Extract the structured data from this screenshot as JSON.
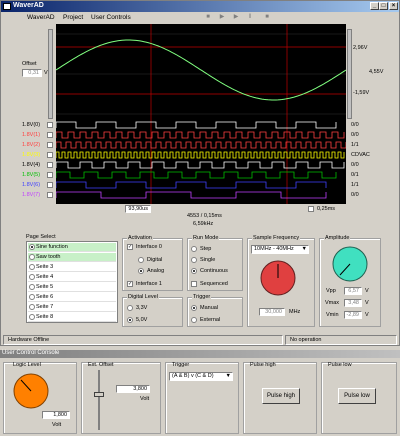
{
  "window": {
    "title": "WaverAD"
  },
  "menu": [
    "WaverAD",
    "Project",
    "User Controls"
  ],
  "scope": {
    "offset_label": "Offset",
    "offset_value": "0,31",
    "offset_unit": "V",
    "top_level": "2,96V",
    "right_level": "4,55V",
    "bottom_level": "-1,59V",
    "channels": [
      {
        "label": "1.8V(0)",
        "value": "0/0",
        "color": "#ffffff"
      },
      {
        "label": "1.8V(1)",
        "value": "0/0",
        "color": "#ff4040"
      },
      {
        "label": "1.8V(2)",
        "value": "1/1",
        "color": "#ff4040"
      },
      {
        "label": "1.8V(3)",
        "value": "CDVAC",
        "color": "#ffff00"
      },
      {
        "label": "1.8V(4)",
        "value": "0/0",
        "color": "#ffffff"
      },
      {
        "label": "1.8V(5)",
        "value": "0/1",
        "color": "#00c000"
      },
      {
        "label": "1.8V(6)",
        "value": "1/1",
        "color": "#4040ff"
      },
      {
        "label": "1.8V(7)",
        "value": "0/0",
        "color": "#c040ff"
      }
    ],
    "cursor_left": "93,90us",
    "cursor_right": "0,25ms",
    "samples": "4553 / 0,15ms",
    "freq": "6,59kHz"
  },
  "page_select": {
    "title": "Page Select",
    "items": [
      "Sine function",
      "Saw tooth",
      "Seite 3",
      "Seite 4",
      "Seite 5",
      "Seite 6",
      "Seite 7",
      "Seite 8"
    ],
    "selected": 0
  },
  "activation": {
    "title": "Activation",
    "interface0": "Interface 0",
    "digital": "Digital",
    "analog": "Analog",
    "interface1": "Interface 1"
  },
  "digital_level": {
    "title": "Digital Level",
    "opt1": "3,3V",
    "opt2": "5,0V"
  },
  "run_mode": {
    "title": "Run Mode",
    "step": "Step",
    "single": "Single",
    "continuous": "Continuous",
    "sequenced": "Sequenced"
  },
  "trigger": {
    "title": "Trigger",
    "manual": "Manual",
    "external": "External"
  },
  "sample_frequency": {
    "title": "Sample Frequency",
    "selected": "10MHz - 40MHz",
    "value": "30,000",
    "unit": "MHz"
  },
  "amplitude": {
    "title": "Amplitude",
    "vpp_label": "Vpp",
    "vpp": "6,57",
    "vmax_label": "Vmax",
    "vmax": "3,48",
    "vmin_label": "Vmin",
    "vmin": "-2,89",
    "unit": "V"
  },
  "status": {
    "left": "Hardware Offline",
    "right": "No operation"
  },
  "console": {
    "title": "User Control Console",
    "logic_level": {
      "title": "Logic Level",
      "value": "1,800",
      "unit": "Volt"
    },
    "ext_offset": {
      "title": "Ext. Offset",
      "value": "3,800",
      "unit": "Volt"
    },
    "trigger": {
      "title": "Trigger",
      "selected": "(A & B) v (C & D)"
    },
    "pulse_high": {
      "title": "Pulse high",
      "button": "Pulse high"
    },
    "pulse_low": {
      "title": "Pulse low",
      "button": "Pulse low"
    }
  },
  "colors": {
    "titlebar": "#0a246a",
    "knob_orange": "#ff8000",
    "knob_red": "#e04040",
    "knob_teal": "#40e0c0",
    "sine": "#80ff80"
  }
}
